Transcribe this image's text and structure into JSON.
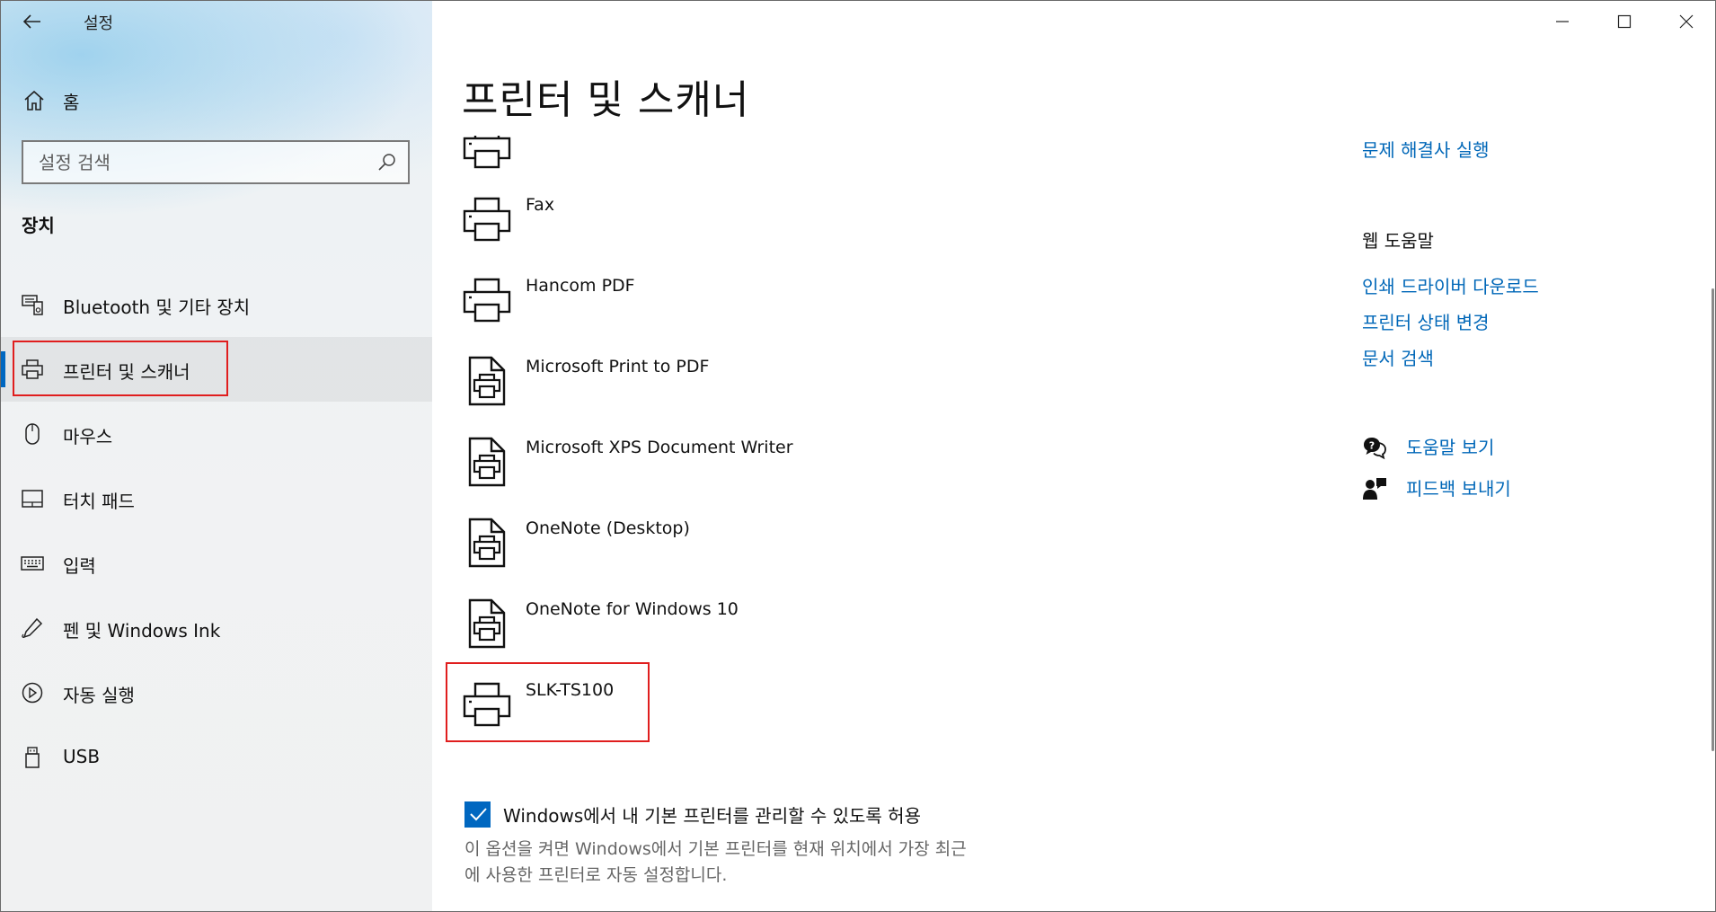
{
  "window": {
    "app_title": "설정",
    "controls": {
      "minimize": "minimize-icon",
      "maximize": "maximize-icon",
      "close": "close-icon"
    }
  },
  "sidebar": {
    "home_label": "홈",
    "search_placeholder": "설정 검색",
    "section_title": "장치",
    "items": [
      {
        "label": "Bluetooth 및 기타 장치",
        "icon": "bluetooth-devices-icon",
        "selected": false
      },
      {
        "label": "프린터 및 스캐너",
        "icon": "printer-icon",
        "selected": true
      },
      {
        "label": "마우스",
        "icon": "mouse-icon",
        "selected": false
      },
      {
        "label": "터치 패드",
        "icon": "touchpad-icon",
        "selected": false
      },
      {
        "label": "입력",
        "icon": "keyboard-icon",
        "selected": false
      },
      {
        "label": "펜 및 Windows Ink",
        "icon": "pen-icon",
        "selected": false
      },
      {
        "label": "자동 실행",
        "icon": "autoplay-icon",
        "selected": false
      },
      {
        "label": "USB",
        "icon": "usb-icon",
        "selected": false
      }
    ]
  },
  "main": {
    "page_title": "프린터 및 스캐너",
    "printers": [
      {
        "name": "",
        "icon": "printer-icon"
      },
      {
        "name": "Fax",
        "icon": "printer-icon"
      },
      {
        "name": "Hancom PDF",
        "icon": "printer-icon"
      },
      {
        "name": "Microsoft Print to PDF",
        "icon": "document-printer-icon"
      },
      {
        "name": "Microsoft XPS Document Writer",
        "icon": "document-printer-icon"
      },
      {
        "name": "OneNote (Desktop)",
        "icon": "document-printer-icon"
      },
      {
        "name": "OneNote for Windows 10",
        "icon": "document-printer-icon"
      },
      {
        "name": "SLK-TS100",
        "icon": "printer-icon"
      }
    ],
    "default_printer_checkbox": {
      "checked": true,
      "label": "Windows에서 내 기본 프린터를 관리할 수 있도록 허용"
    },
    "default_printer_description_line1": "이 옵션을 켜면 Windows에서 기본 프린터를 현재 위치에서 가장 최근",
    "default_printer_description_line2": "에 사용한 프린터로 자동 설정합니다."
  },
  "related": {
    "troubleshooter_link": "문제 해결사 실행",
    "web_help_heading": "웹 도움말",
    "links": [
      "인쇄 드라이버 다운로드",
      "프린터 상태 변경",
      "문서 검색"
    ],
    "get_help": "도움말 보기",
    "give_feedback": "피드백 보내기"
  },
  "colors": {
    "accent": "#0067c0",
    "link": "#0067b8",
    "highlight": "#e01e1e"
  }
}
